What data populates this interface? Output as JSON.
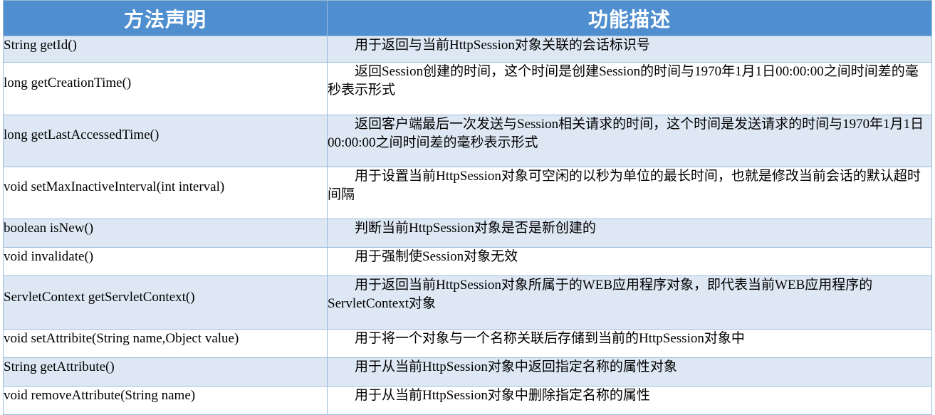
{
  "header": {
    "col_method": "方法声明",
    "col_desc": "功能描述"
  },
  "rows": [
    {
      "method": "String getId()",
      "desc": "用于返回与当前HttpSession对象关联的会话标识号"
    },
    {
      "method": "long getCreationTime()",
      "desc": "返回Session创建的时间，这个时间是创建Session的时间与1970年1月1日00:00:00之间时间差的毫秒表示形式"
    },
    {
      "method": "long getLastAccessedTime()",
      "desc": "返回客户端最后一次发送与Session相关请求的时间，这个时间是发送请求的时间与1970年1月1日00:00:00之间时间差的毫秒表示形式"
    },
    {
      "method": "void setMaxInactiveInterval(int interval)",
      "desc": "用于设置当前HttpSession对象可空闲的以秒为单位的最长时间，也就是修改当前会话的默认超时间隔"
    },
    {
      "method": "boolean isNew()",
      "desc": "判断当前HttpSession对象是否是新创建的"
    },
    {
      "method": "void invalidate()",
      "desc": "用于强制使Session对象无效"
    },
    {
      "method": "ServletContext getServletContext()",
      "desc": "用于返回当前HttpSession对象所属于的WEB应用程序对象，即代表当前WEB应用程序的ServletContext对象"
    },
    {
      "method": "void setAttribite(String name,Object value)",
      "desc": "用于将一个对象与一个名称关联后存储到当前的HttpSession对象中"
    },
    {
      "method": "String getAttribute()",
      "desc": "用于从当前HttpSession对象中返回指定名称的属性对象"
    },
    {
      "method": "void removeAttribute(String name)",
      "desc": "用于从当前HttpSession对象中删除指定名称的属性"
    }
  ],
  "colors": {
    "header_bg": "#4f8fcf",
    "stripe_bg": "#dde8f4",
    "border": "#9bbad9"
  }
}
